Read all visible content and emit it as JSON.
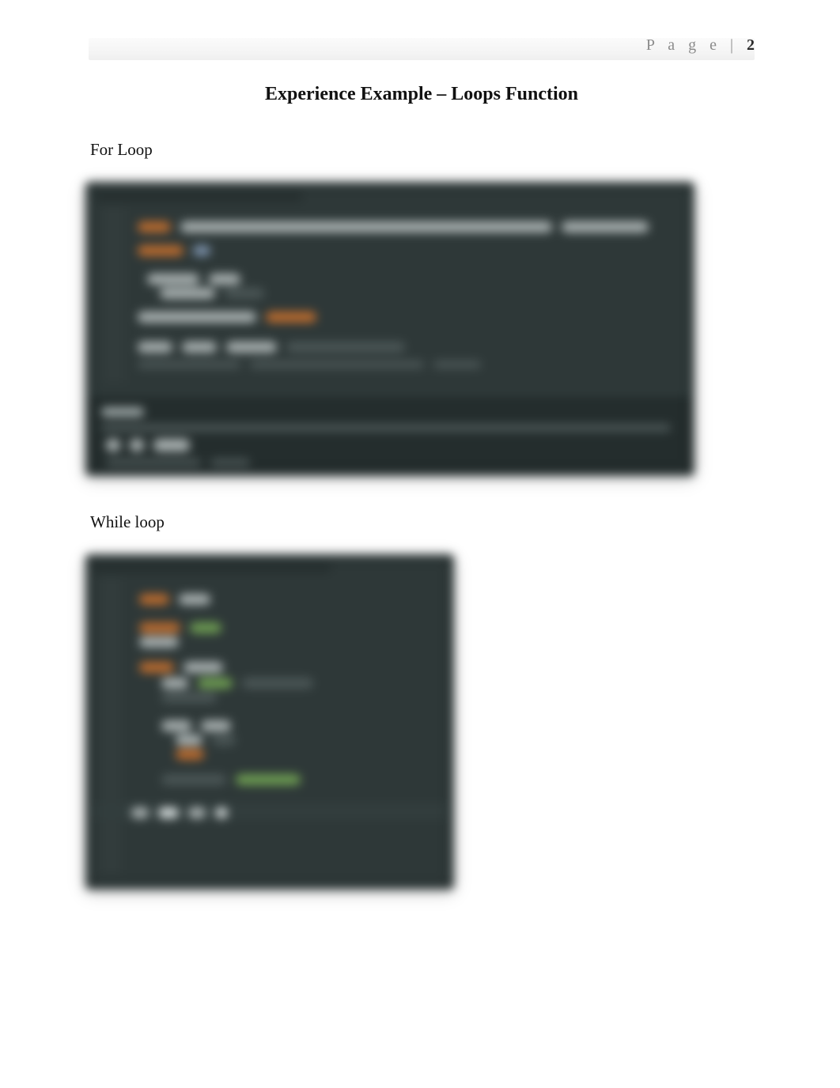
{
  "header": {
    "page_label_prefix": "P a g e",
    "page_label_sep": "|",
    "page_number": "2"
  },
  "title": "Experience Example – Loops Function",
  "sections": {
    "for_loop_label": "For Loop",
    "while_loop_label": "While loop"
  }
}
